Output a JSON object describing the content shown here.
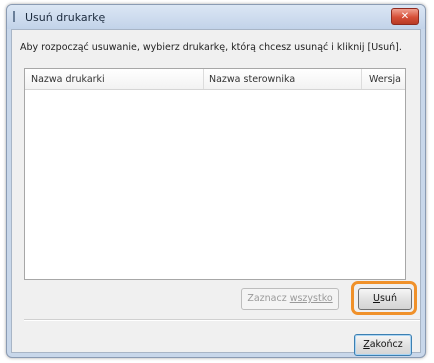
{
  "window": {
    "title": "Usuń drukarkę",
    "close_glyph": "✕"
  },
  "instruction": "Aby rozpocząć usuwanie, wybierz drukarkę, którą chcesz usunąć i kliknij [Usuń].",
  "list": {
    "columns": [
      "Nazwa drukarki",
      "Nazwa sterownika",
      "Wersja"
    ],
    "rows": []
  },
  "buttons": {
    "select_all_prefix": "Zaznacz ",
    "select_all_accel": "wszystko",
    "remove_accel": "U",
    "remove_rest": "suń",
    "close_accel": "Z",
    "close_rest": "akończ"
  },
  "colors": {
    "highlight": "#f0912a",
    "titlebar": "#c8d7ea",
    "close_button": "#d64f38"
  },
  "icons": [
    "printer-icon",
    "close-icon"
  ]
}
